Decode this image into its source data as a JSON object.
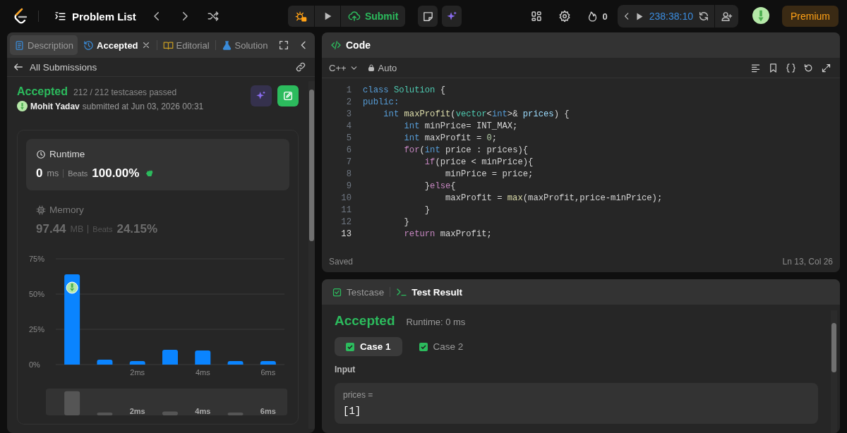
{
  "top_bar": {
    "problem_list": "Problem List",
    "submit": "Submit",
    "streak": "0",
    "timer": "238:38:10",
    "premium": "Premium"
  },
  "left_panel": {
    "tabs": [
      {
        "label": "Description",
        "selected": false,
        "highlighted": true,
        "closable": false
      },
      {
        "label": "Accepted",
        "selected": true,
        "highlighted": false,
        "closable": true
      },
      {
        "label": "Editorial",
        "selected": false,
        "highlighted": false,
        "closable": false
      },
      {
        "label": "Solution",
        "selected": false,
        "highlighted": false,
        "closable": false
      }
    ],
    "back_link": "All Submissions",
    "submission": {
      "status": "Accepted",
      "testcases": "212 / 212 testcases passed",
      "author": "Mohit Yadav",
      "submitted": "submitted at Jun 03, 2026 00:31"
    },
    "metrics": [
      {
        "kind": "runtime",
        "label": "Runtime",
        "value": "0",
        "unit": "ms",
        "beats_label": "Beats",
        "beats": "100.00%",
        "selected": true,
        "celebration_icon": true
      },
      {
        "kind": "memory",
        "label": "Memory",
        "value": "97.44",
        "unit": "MB",
        "beats_label": "Beats",
        "beats": "24.15%",
        "selected": false,
        "celebration_icon": false
      }
    ],
    "chart_data": {
      "type": "bar",
      "x": [
        0,
        1,
        2,
        3,
        4,
        5,
        6
      ],
      "xlim": [
        -0.5,
        6.5
      ],
      "values": [
        64,
        3.5,
        2.5,
        10.5,
        10,
        2.5,
        2.5
      ],
      "xticks": [
        {
          "value": 2,
          "label": "2ms"
        },
        {
          "value": 4,
          "label": "4ms"
        },
        {
          "value": 6,
          "label": "6ms"
        }
      ],
      "yticks": [
        {
          "value": 0,
          "label": "0%"
        },
        {
          "value": 25,
          "label": "25%"
        },
        {
          "value": 50,
          "label": "50%"
        },
        {
          "value": 75,
          "label": "75%"
        }
      ],
      "ylim": [
        0,
        75
      ]
    },
    "avatar_marker": true,
    "overview": {
      "labels": [
        "2ms",
        "4ms",
        "6ms"
      ]
    }
  },
  "editor": {
    "title": "Code",
    "language": "C++",
    "mode": "Auto",
    "status": "Saved",
    "cursor": "Ln 13, Col 26",
    "lines": [
      {
        "number": "1",
        "current": false,
        "tokens": [
          {
            "text": "class",
            "kind": "keyword"
          },
          {
            "text": " Solution",
            "kind": "type"
          },
          {
            "text": " {",
            "kind": "plain"
          }
        ]
      },
      {
        "number": "2",
        "current": false,
        "tokens": [
          {
            "text": "public:",
            "kind": "keyword"
          }
        ]
      },
      {
        "number": "3",
        "current": false,
        "tokens": [
          {
            "text": "    int",
            "kind": "keyword"
          },
          {
            "text": " maxProfit",
            "kind": "function"
          },
          {
            "text": "(",
            "kind": "plain"
          },
          {
            "text": "vector",
            "kind": "type"
          },
          {
            "text": "<",
            "kind": "plain"
          },
          {
            "text": "int",
            "kind": "keyword"
          },
          {
            "text": ">& ",
            "kind": "plain"
          },
          {
            "text": "prices",
            "kind": "param"
          },
          {
            "text": ") {",
            "kind": "plain"
          }
        ]
      },
      {
        "number": "4",
        "current": false,
        "tokens": [
          {
            "text": "        int",
            "kind": "keyword"
          },
          {
            "text": " minPrice= INT_MAX;",
            "kind": "plain"
          }
        ]
      },
      {
        "number": "5",
        "current": false,
        "tokens": [
          {
            "text": "        int",
            "kind": "keyword"
          },
          {
            "text": " maxProfit = ",
            "kind": "plain"
          },
          {
            "text": "0",
            "kind": "number"
          },
          {
            "text": ";",
            "kind": "plain"
          }
        ]
      },
      {
        "number": "6",
        "current": false,
        "tokens": [
          {
            "text": "        for",
            "kind": "control"
          },
          {
            "text": "(",
            "kind": "plain"
          },
          {
            "text": "int",
            "kind": "keyword"
          },
          {
            "text": " price : prices){",
            "kind": "plain"
          }
        ]
      },
      {
        "number": "7",
        "current": false,
        "tokens": [
          {
            "text": "            if",
            "kind": "control"
          },
          {
            "text": "(price < minPrice){",
            "kind": "plain"
          }
        ]
      },
      {
        "number": "8",
        "current": false,
        "tokens": [
          {
            "text": "                minPrice = price;",
            "kind": "plain"
          }
        ]
      },
      {
        "number": "9",
        "current": false,
        "tokens": [
          {
            "text": "            }",
            "kind": "plain"
          },
          {
            "text": "else",
            "kind": "control"
          },
          {
            "text": "{",
            "kind": "plain"
          }
        ]
      },
      {
        "number": "10",
        "current": false,
        "tokens": [
          {
            "text": "                maxProfit = ",
            "kind": "plain"
          },
          {
            "text": "max",
            "kind": "function"
          },
          {
            "text": "(maxProfit,price-minPrice);",
            "kind": "plain"
          }
        ]
      },
      {
        "number": "11",
        "current": false,
        "tokens": [
          {
            "text": "            }",
            "kind": "plain"
          }
        ]
      },
      {
        "number": "12",
        "current": false,
        "tokens": [
          {
            "text": "        }",
            "kind": "plain"
          }
        ]
      },
      {
        "number": "13",
        "current": true,
        "tokens": [
          {
            "text": "        return",
            "kind": "control"
          },
          {
            "text": " maxProfit;",
            "kind": "plain"
          }
        ]
      }
    ]
  },
  "results": {
    "tabs": [
      {
        "label": "Testcase",
        "selected": false
      },
      {
        "label": "Test Result",
        "selected": true
      }
    ],
    "verdict": "Accepted",
    "runtime": "Runtime: 0 ms",
    "cases": [
      {
        "label": "Case 1",
        "selected": true,
        "passed": true
      },
      {
        "label": "Case 2",
        "selected": false,
        "passed": true
      }
    ],
    "input_heading": "Input",
    "inputs": [
      {
        "name": "prices =",
        "value": "[1]"
      }
    ]
  }
}
